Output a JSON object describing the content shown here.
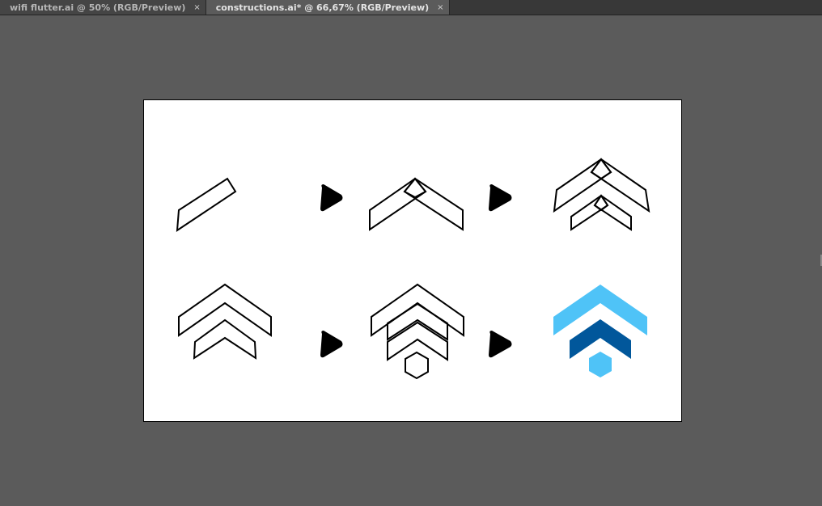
{
  "tabs": [
    {
      "label": "wifi flutter.ai @ 50% (RGB/Preview)",
      "active": false,
      "close": "×"
    },
    {
      "label": "constructions.ai* @ 66,67% (RGB/Preview)",
      "active": true,
      "close": "×"
    }
  ],
  "colors": {
    "workspace": "#5b5b5b",
    "artboard": "#ffffff",
    "outline": "#000000",
    "light_blue": "#4fc3f7",
    "dark_blue": "#01579b"
  }
}
